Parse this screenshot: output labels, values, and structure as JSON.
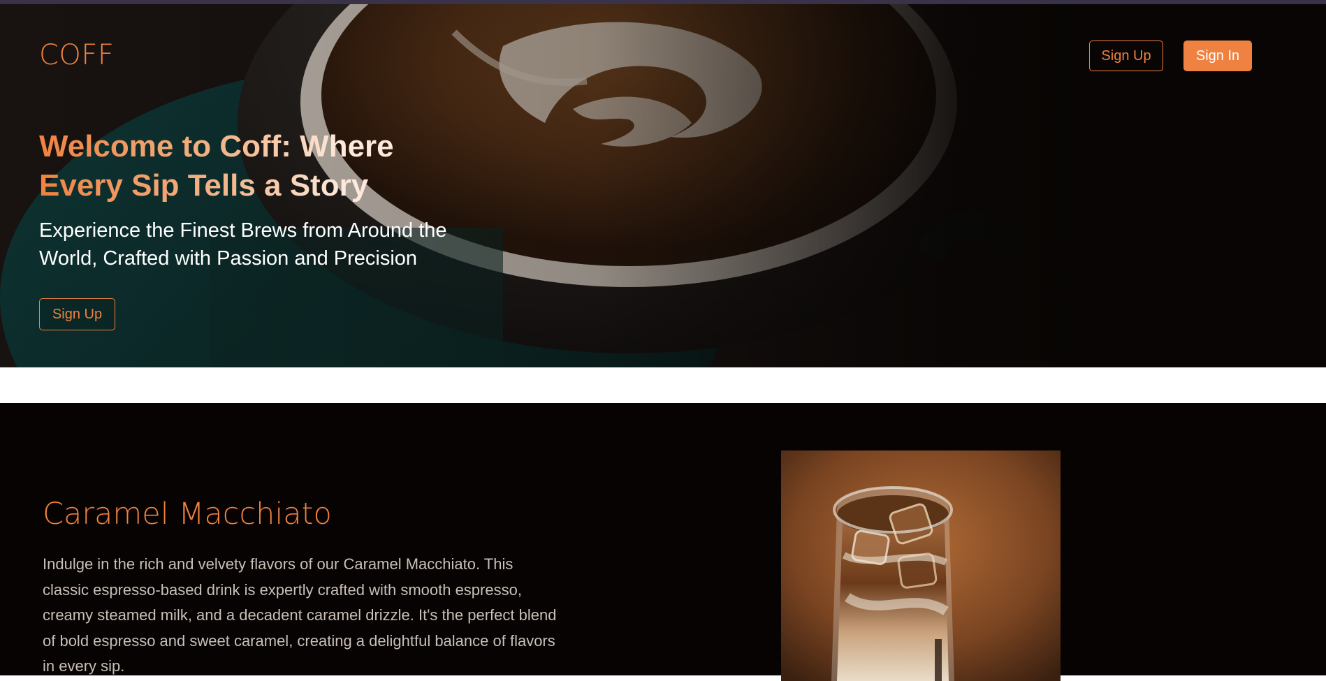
{
  "header": {
    "logo": "COFF",
    "signup_label": "Sign Up",
    "signin_label": "Sign In"
  },
  "hero": {
    "title": "Welcome to Coff: Where Every Sip Tells a Story",
    "subtitle": "Experience the Finest Brews from Around the World, Crafted with Passion and Precision",
    "cta_label": "Sign Up"
  },
  "product": {
    "title": "Caramel Macchiato",
    "description": "Indulge in the rich and velvety flavors of our Caramel Macchiato. This classic espresso-based drink is expertly crafted with smooth espresso, creamy steamed milk, and a decadent caramel drizzle. It's the perfect blend of bold espresso and sweet caramel, creating a delightful balance of flavors in every sip."
  },
  "colors": {
    "accent": "#ef8240",
    "dark_background": "#060302",
    "body_text": "#c9bfb8"
  }
}
